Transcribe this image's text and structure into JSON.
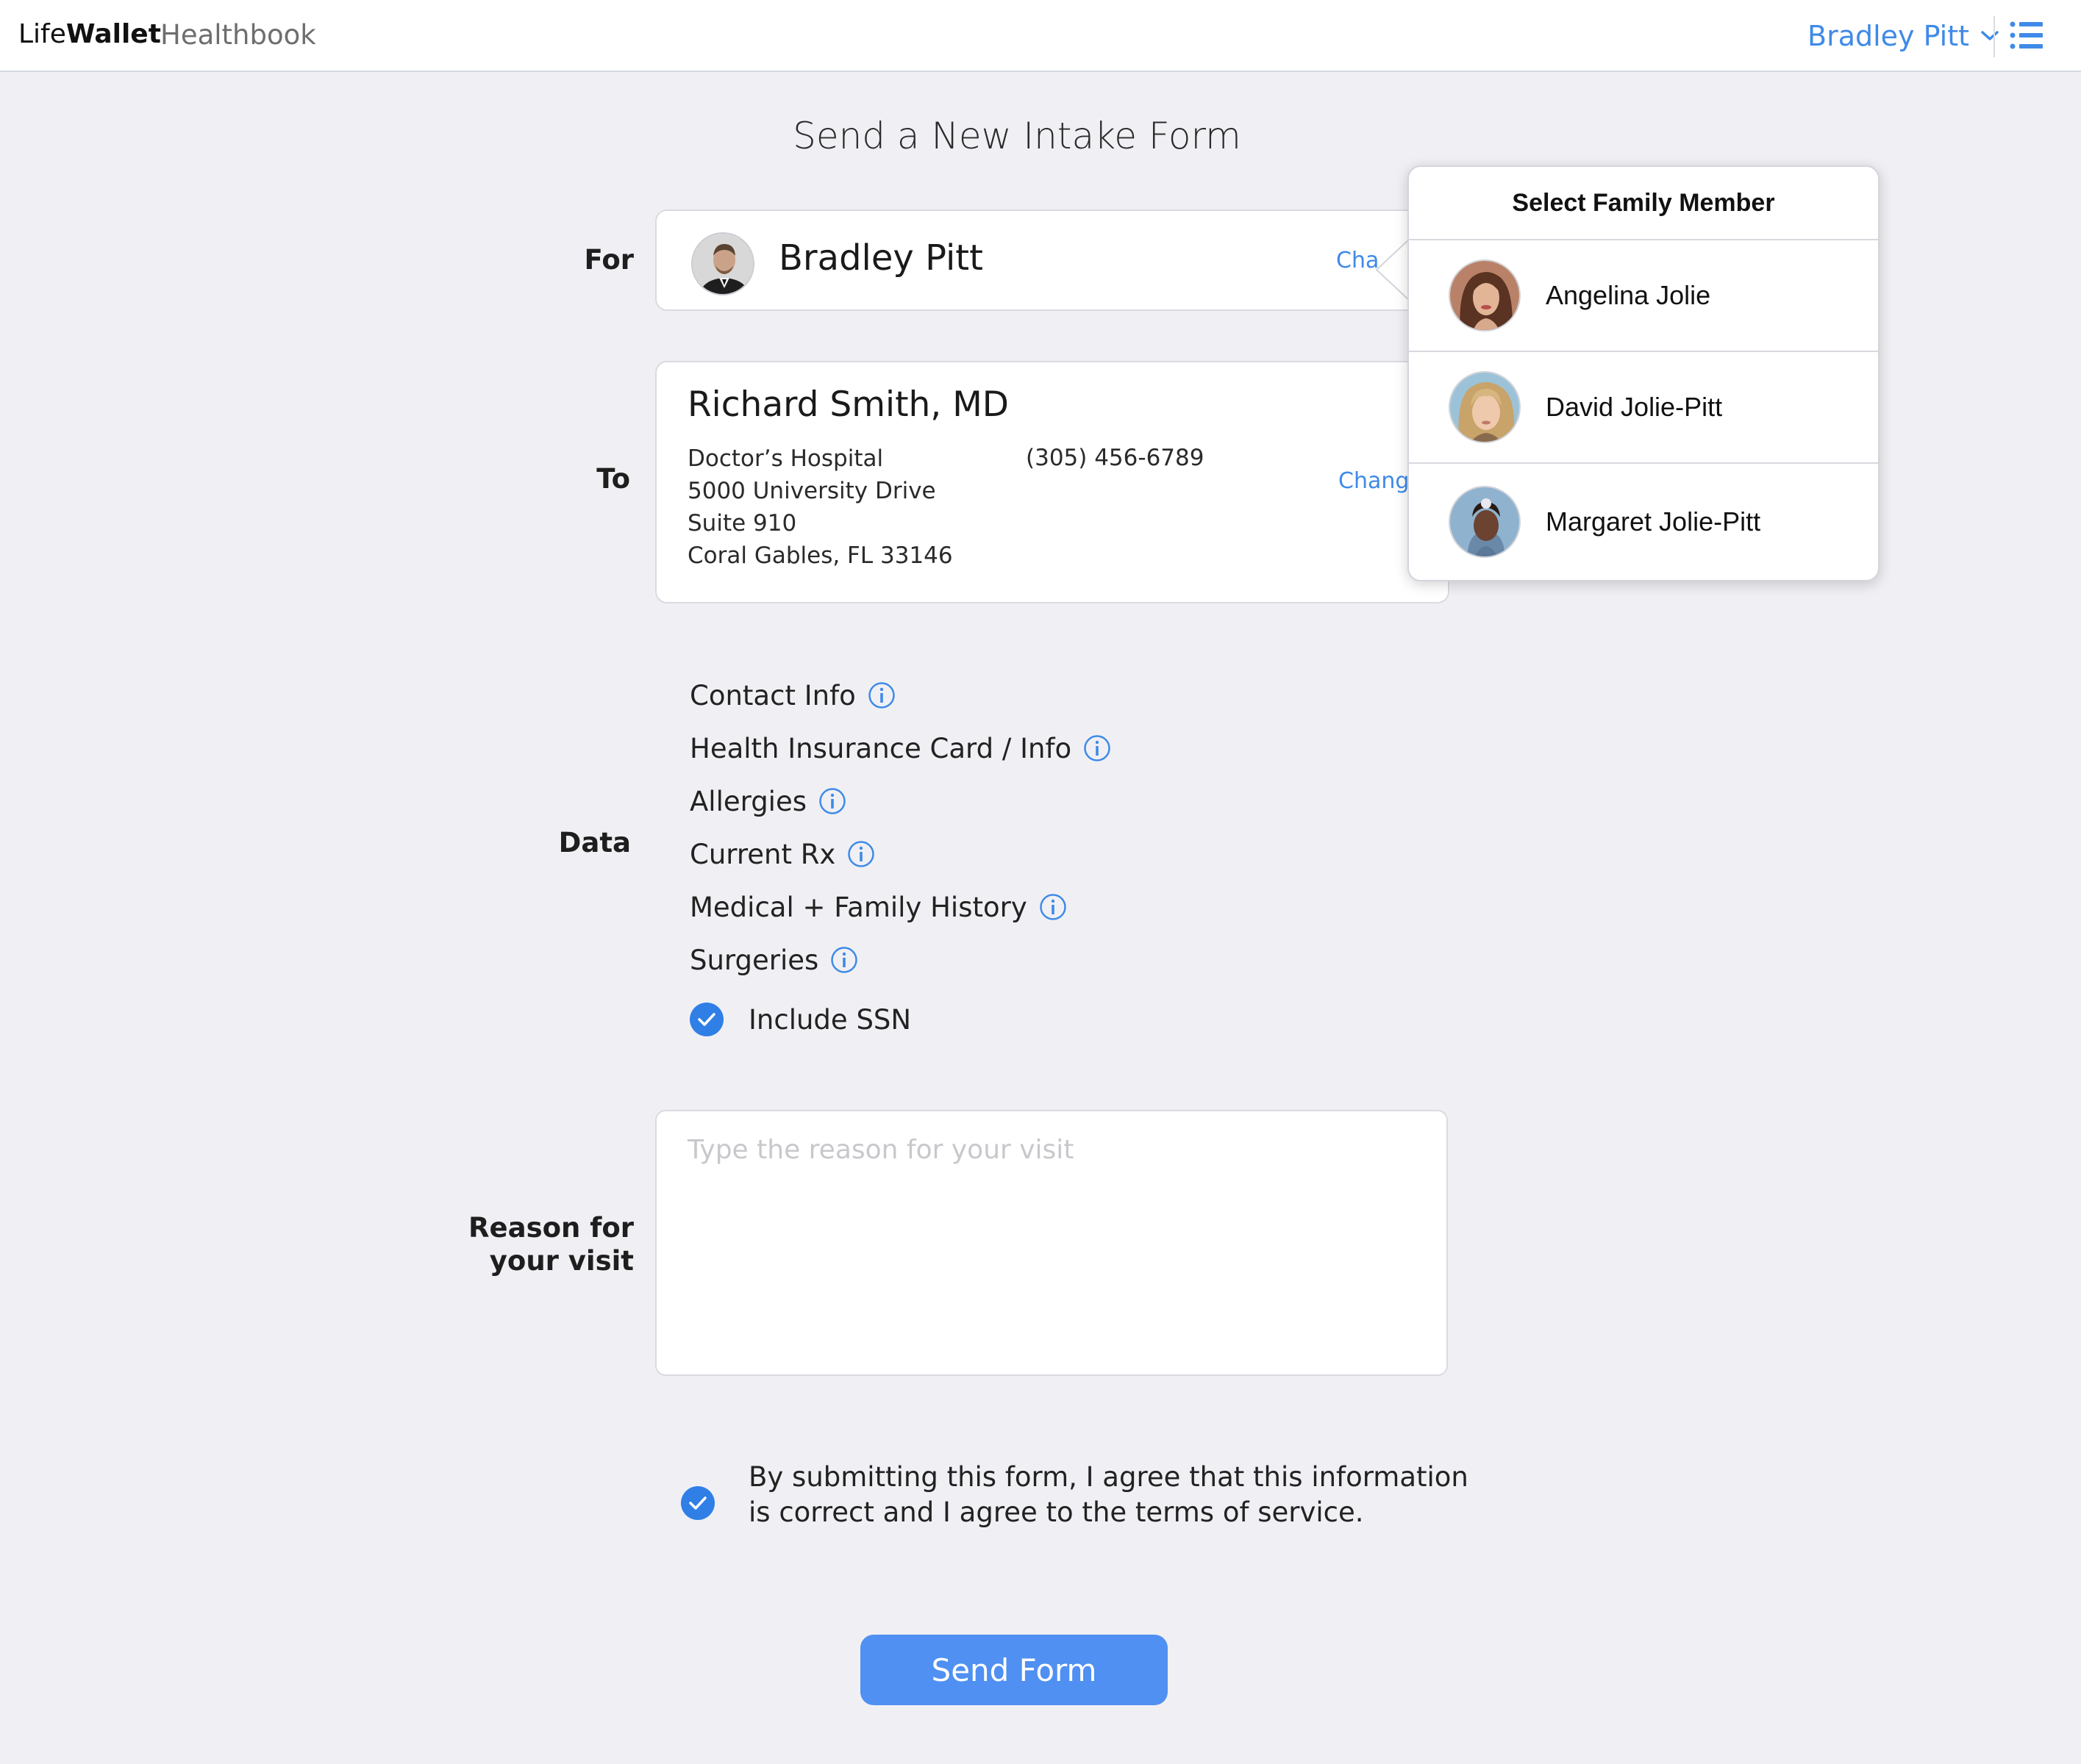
{
  "header": {
    "brand_light": "Life",
    "brand_bold": "Wallet",
    "section": "Healthbook",
    "user_name": "Bradley Pitt"
  },
  "page_title": "Send a New Intake Form",
  "for_section": {
    "label": "For",
    "name": "Bradley Pitt",
    "change_label": "Change"
  },
  "to_section": {
    "label": "To",
    "doctor": "Richard Smith, MD",
    "address_lines": [
      "Doctor’s Hospital",
      "5000 University Drive",
      "Suite 910",
      "Coral Gables, FL 33146"
    ],
    "phone": "(305) 456-6789",
    "change_label": "Change"
  },
  "data_section": {
    "label": "Data",
    "items": [
      "Contact Info",
      "Health Insurance Card / Info",
      "Allergies",
      "Current Rx",
      "Medical + Family History",
      "Surgeries"
    ],
    "ssn_label": "Include SSN",
    "ssn_checked": true
  },
  "reason_section": {
    "label_line1": "Reason for",
    "label_line2": "your visit",
    "placeholder": "Type the reason for your visit"
  },
  "agreement": {
    "text": "By submitting this form, I agree that this information is correct and I agree to the terms of service.",
    "checked": true
  },
  "send_button": "Send Form",
  "family_popover": {
    "title": "Select Family Member",
    "members": [
      "Angelina Jolie",
      "David Jolie-Pitt",
      "Margaret Jolie-Pitt"
    ]
  },
  "colors": {
    "accent": "#3f8ae8",
    "button": "#4f90f2",
    "background": "#f0f0f4"
  }
}
